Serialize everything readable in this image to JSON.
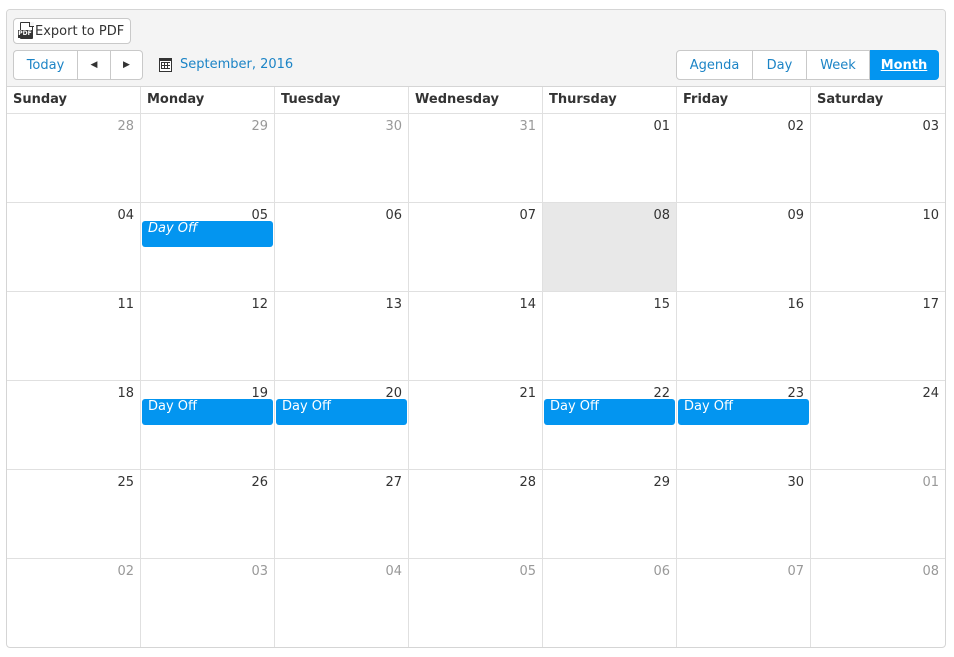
{
  "toolbar": {
    "export_label": "Export to PDF",
    "export_icon": "pdf-file-icon",
    "pdf_tag": "PDF",
    "today_label": "Today",
    "prev_glyph": "◀",
    "next_glyph": "▶",
    "date_icon": "calendar-icon",
    "current_date": "September, 2016",
    "views": [
      {
        "label": "Agenda",
        "active": false
      },
      {
        "label": "Day",
        "active": false
      },
      {
        "label": "Week",
        "active": false
      },
      {
        "label": "Month",
        "active": true
      }
    ]
  },
  "colors": {
    "accent": "#0395f0",
    "link": "#1c84c6",
    "today_bg": "#e8e8e8",
    "toolbar_bg": "#f4f4f4"
  },
  "day_headers": [
    "Sunday",
    "Monday",
    "Tuesday",
    "Wednesday",
    "Thursday",
    "Friday",
    "Saturday"
  ],
  "weeks": [
    [
      {
        "d": "28",
        "other": true
      },
      {
        "d": "29",
        "other": true
      },
      {
        "d": "30",
        "other": true
      },
      {
        "d": "31",
        "other": true
      },
      {
        "d": "01"
      },
      {
        "d": "02"
      },
      {
        "d": "03"
      }
    ],
    [
      {
        "d": "04"
      },
      {
        "d": "05",
        "event": "Day Off",
        "italic": true
      },
      {
        "d": "06"
      },
      {
        "d": "07"
      },
      {
        "d": "08",
        "today": true
      },
      {
        "d": "09"
      },
      {
        "d": "10"
      }
    ],
    [
      {
        "d": "11"
      },
      {
        "d": "12"
      },
      {
        "d": "13"
      },
      {
        "d": "14"
      },
      {
        "d": "15"
      },
      {
        "d": "16"
      },
      {
        "d": "17"
      }
    ],
    [
      {
        "d": "18"
      },
      {
        "d": "19",
        "event": "Day Off"
      },
      {
        "d": "20",
        "event": "Day Off"
      },
      {
        "d": "21"
      },
      {
        "d": "22",
        "event": "Day Off"
      },
      {
        "d": "23",
        "event": "Day Off"
      },
      {
        "d": "24"
      }
    ],
    [
      {
        "d": "25"
      },
      {
        "d": "26"
      },
      {
        "d": "27"
      },
      {
        "d": "28"
      },
      {
        "d": "29"
      },
      {
        "d": "30"
      },
      {
        "d": "01",
        "other": true
      }
    ],
    [
      {
        "d": "02",
        "other": true
      },
      {
        "d": "03",
        "other": true
      },
      {
        "d": "04",
        "other": true
      },
      {
        "d": "05",
        "other": true
      },
      {
        "d": "06",
        "other": true
      },
      {
        "d": "07",
        "other": true
      },
      {
        "d": "08",
        "other": true
      }
    ]
  ]
}
